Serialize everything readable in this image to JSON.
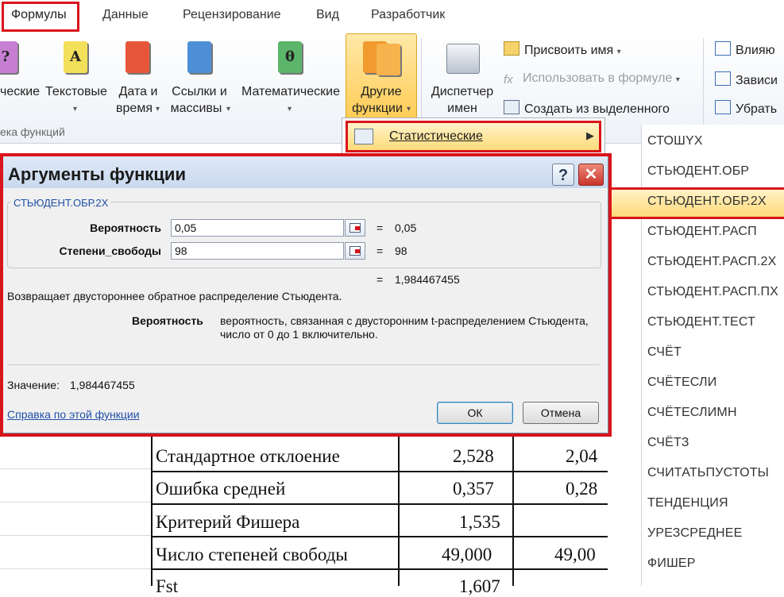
{
  "ribbon_tabs": [
    {
      "label": "Формулы",
      "active": true
    },
    {
      "label": "Данные"
    },
    {
      "label": "Рецензирование"
    },
    {
      "label": "Вид"
    },
    {
      "label": "Разработчик"
    }
  ],
  "ribbon": {
    "groups": {
      "logical_partial_line1": "ческие",
      "text_line1": "Текстовые",
      "datetime_line1": "Дата и",
      "datetime_line2": "время",
      "lookup_line1": "Ссылки и",
      "lookup_line2": "массивы",
      "math_line1": "Математические",
      "other_line1": "Другие",
      "other_line2": "функции",
      "name_manager_line1": "Диспетчер",
      "name_manager_line2": "имен",
      "library_label_partial": "ека функций"
    },
    "names_commands": {
      "assign_name": "Присвоить имя",
      "use_in_formula": "Использовать в формуле",
      "create_from_selection": "Создать из выделенного"
    },
    "audit_commands": {
      "precedents_partial": "Влияю",
      "dependents_partial": "Зависи",
      "remove_partial": "Убрать"
    },
    "book_glyphs": {
      "logical": "?",
      "text": "A",
      "math": "θ"
    },
    "caret": "▾"
  },
  "dropdown": {
    "statistical": "Статистические",
    "submenu_arrow": "▶"
  },
  "function_list": [
    "СТОШYX",
    "СТЬЮДЕНТ.ОБР",
    "СТЬЮДЕНТ.ОБР.2Х",
    "СТЬЮДЕНТ.РАСП",
    "СТЬЮДЕНТ.РАСП.2Х",
    "СТЬЮДЕНТ.РАСП.ПХ",
    "СТЬЮДЕНТ.ТЕСТ",
    "СЧЁТ",
    "СЧЁТЕСЛИ",
    "СЧЁТЕСЛИМН",
    "СЧЁТЗ",
    "СЧИТАТЬПУСТОТЫ",
    "ТЕНДЕНЦИЯ",
    "УРЕЗСРЕДНЕЕ",
    "ФИШЕР"
  ],
  "function_list_selected": "СТЬЮДЕНТ.ОБР.2Х",
  "dialog": {
    "title": "Аргументы функции",
    "help_glyph": "?",
    "close_glyph": "✕",
    "function_name": "СТЬЮДЕНТ.ОБР.2Х",
    "args": [
      {
        "label": "Вероятность",
        "value": "0,05",
        "result": "0,05"
      },
      {
        "label": "Степени_свободы",
        "value": "98",
        "result": "98"
      }
    ],
    "equals": "=",
    "formula_result": "1,984467455",
    "description": "Возвращает двустороннее обратное распределение Стьюдента.",
    "arg_help_name": "Вероятность",
    "arg_help_line1": "вероятность, связанная с двусторонним t-распределением Стьюдента,",
    "arg_help_line2": "число от 0 до 1 включительно.",
    "value_label": "Значение:",
    "value": "1,984467455",
    "help_link": "Справка по этой функции",
    "ok": "ОК",
    "cancel": "Отмена"
  },
  "sheet_rows": [
    {
      "label": "Стандартное отклоение",
      "v1": "2,528",
      "v2": "2,04"
    },
    {
      "label": "Ошибка средней",
      "v1": "0,357",
      "v2": "0,28"
    },
    {
      "label": "Критерий Фишера",
      "v1": "1,535",
      "v2": ""
    },
    {
      "label": "Число степеней свободы",
      "v1": "49,000",
      "v2": "49,00"
    },
    {
      "label": "Fst",
      "v1": "1,607",
      "v2": ""
    }
  ],
  "colors": {
    "highlight_red": "#d9141b",
    "menu_highlight": "#ffd978",
    "link_blue": "#1f4fa8"
  }
}
